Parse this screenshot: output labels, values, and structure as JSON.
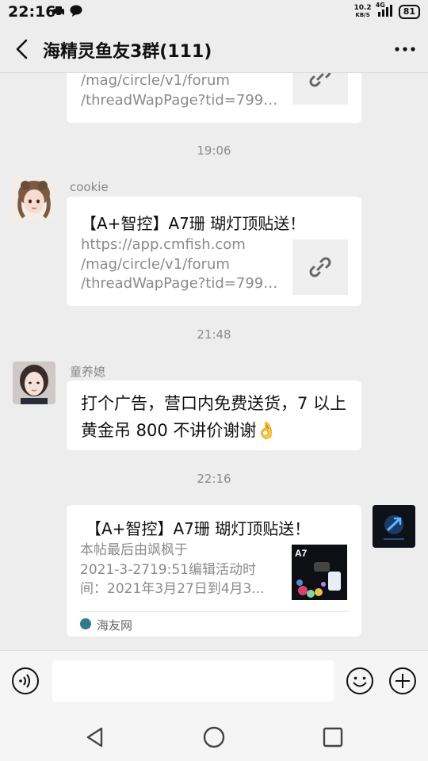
{
  "status": {
    "time": "22:16",
    "net_speed_value": "10.2",
    "net_speed_unit": "KB/S",
    "network_type": "4G",
    "battery": "81"
  },
  "header": {
    "title": "海精灵鱼友3群(111)"
  },
  "messages": [
    {
      "kind": "link-partial",
      "url_lines": [
        "/mag/circle/v1/forum",
        "/threadWapPage?tid=79930..."
      ]
    },
    {
      "kind": "time",
      "text": "19:06"
    },
    {
      "kind": "link",
      "sender": "cookie",
      "title": "【A+智控】A7珊 瑚灯顶贴送！",
      "url_lines": [
        "https://app.cmfish.com",
        "/mag/circle/v1/forum",
        "/threadWapPage?tid=79930..."
      ]
    },
    {
      "kind": "time",
      "text": "21:48"
    },
    {
      "kind": "text",
      "sender": "童养媳",
      "text": "打个广告，营口内免费送货，7 以上黄金吊 800 不讲价谢谢👌"
    },
    {
      "kind": "time",
      "text": "22:16"
    },
    {
      "kind": "card",
      "title": "【A+智控】A7珊 瑚灯顶贴送！",
      "desc_lines": [
        "本帖最后由飒枫于",
        "2021-3-2719:51编辑活动时",
        "间：2021年3月27日到4月3..."
      ],
      "thumb_text": "A7",
      "source": "海友网"
    }
  ],
  "input": {
    "placeholder": ""
  }
}
